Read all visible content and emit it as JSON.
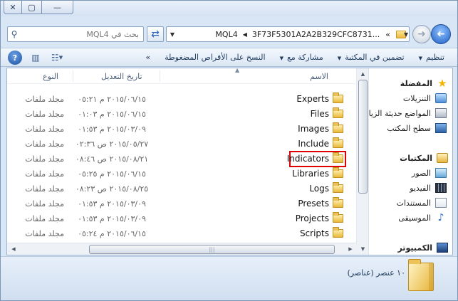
{
  "window": {
    "caption_buttons": {
      "close": "✕",
      "maximize": "▢",
      "minimize": "—"
    }
  },
  "address_bar": {
    "search_placeholder": "بحث في MQL4",
    "breadcrumb": [
      "«",
      "3F73F5301A2A2B329CFC8731...",
      "MQL4"
    ]
  },
  "toolbar": {
    "items": [
      "تنظيم",
      "تضمين في المكتبة",
      "مشاركة مع",
      "النسخ على الأقراص المضغوطة",
      "»"
    ]
  },
  "nav_pane": {
    "favorites_header": "المفضلة",
    "favorites": [
      "التنزيلات",
      "المواضع حديثة الزيا",
      "سطح المكتب"
    ],
    "libraries_header": "المكتبات",
    "libraries": [
      "الصور",
      "الفيديو",
      "المستندات",
      "الموسيقى"
    ],
    "computer_header": "الكمبيوتر"
  },
  "file_list": {
    "columns": {
      "name": "الاسم",
      "date": "تاريخ التعديل",
      "type": "النوع"
    },
    "rows": [
      {
        "name": "Experts",
        "date": "٢٠١٥/٠٦/١٥ م ٠٥:٢١",
        "type": "مجلد ملفات"
      },
      {
        "name": "Files",
        "date": "٢٠١٥/٠٦/١٥ م ٠١:٠٣",
        "type": "مجلد ملفات"
      },
      {
        "name": "Images",
        "date": "٢٠١٥/٠٣/٠٩ م ٠١:٥٣",
        "type": "مجلد ملفات"
      },
      {
        "name": "Include",
        "date": "٢٠١٥/٠٥/٢٧ ص ٠٢:٣٦",
        "type": "مجلد ملفات"
      },
      {
        "name": "Indicators",
        "date": "٢٠١٥/٠٨/٢١ ص ٠٨:٤٦",
        "type": "مجلد ملفات"
      },
      {
        "name": "Libraries",
        "date": "٢٠١٥/٠٦/١٥ م ٠٥:٢٥",
        "type": "مجلد ملفات"
      },
      {
        "name": "Logs",
        "date": "٢٠١٥/٠٨/٢٥ ص ٠٨:٢٣",
        "type": "مجلد ملفات"
      },
      {
        "name": "Presets",
        "date": "٢٠١٥/٠٣/٠٩ م ٠١:٥٣",
        "type": "مجلد ملفات"
      },
      {
        "name": "Projects",
        "date": "٢٠١٥/٠٣/٠٩ م ٠١:٥٣",
        "type": "مجلد ملفات"
      },
      {
        "name": "Scripts",
        "date": "٢٠١٥/٠٦/١٥ م ٠٥:٢٤",
        "type": "مجلد ملفات"
      }
    ],
    "highlighted": "Indicators"
  },
  "details": {
    "count": "١٠ عنصر (عناصر)"
  }
}
